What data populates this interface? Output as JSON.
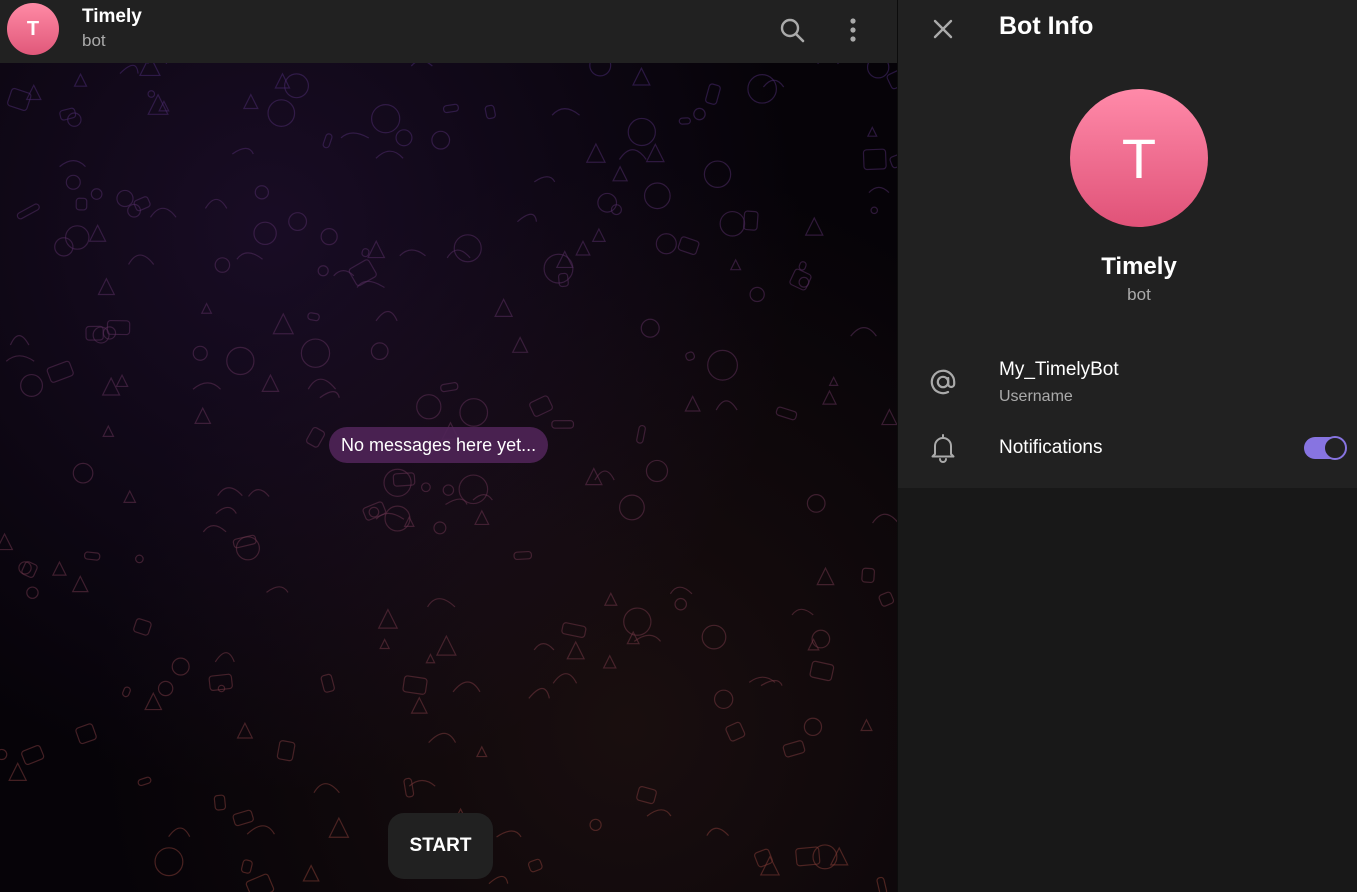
{
  "chat": {
    "header": {
      "avatar_letter": "T",
      "title": "Timely",
      "subtitle": "bot",
      "icons": [
        "search-icon",
        "more-vertical-icon"
      ]
    },
    "empty_message": "No messages here yet...",
    "start_label": "START"
  },
  "panel": {
    "title": "Bot Info",
    "close_icon": "close-icon",
    "avatar_letter": "T",
    "name": "Timely",
    "subtitle": "bot",
    "username": {
      "value": "My_TimelyBot",
      "label": "Username",
      "icon": "at-sign-icon"
    },
    "notifications": {
      "label": "Notifications",
      "icon": "bell-icon",
      "enabled": true
    }
  },
  "colors": {
    "accent": "#8774e1",
    "header_bg": "#212121",
    "panel_bg": "#181818",
    "avatar_gradient": [
      "#ff8aa5",
      "#e0587a"
    ],
    "empty_pill_bg": "#4e2456"
  }
}
